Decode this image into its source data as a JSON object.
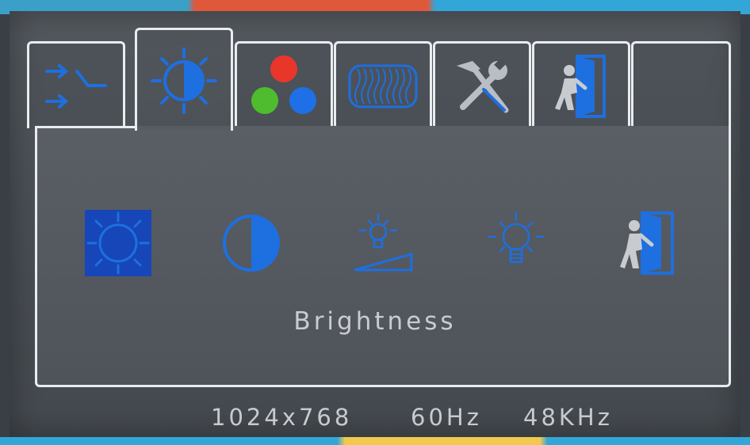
{
  "tabs": [
    {
      "icon": "input-select-icon"
    },
    {
      "icon": "brightness-contrast-icon",
      "active": true
    },
    {
      "icon": "color-rgb-icon"
    },
    {
      "icon": "image-phase-icon"
    },
    {
      "icon": "tools-icon"
    },
    {
      "icon": "exit-icon"
    },
    {
      "icon": "empty"
    }
  ],
  "items": [
    {
      "icon": "brightness-icon",
      "selected": true
    },
    {
      "icon": "contrast-icon"
    },
    {
      "icon": "backlight-level-icon"
    },
    {
      "icon": "dynamic-contrast-bulb-icon"
    },
    {
      "icon": "exit-icon"
    }
  ],
  "selected_label": "Brightness",
  "status": {
    "resolution": "1024x768",
    "vertical_freq": "60Hz",
    "horizontal_freq": "48KHz"
  },
  "colors": {
    "accent_blue": "#1e6fe0",
    "selection_bg": "#1646b8",
    "frame_line": "#e9ecef",
    "red": "#e8362b",
    "green": "#4fbb2f",
    "blue": "#1f6fe6"
  }
}
